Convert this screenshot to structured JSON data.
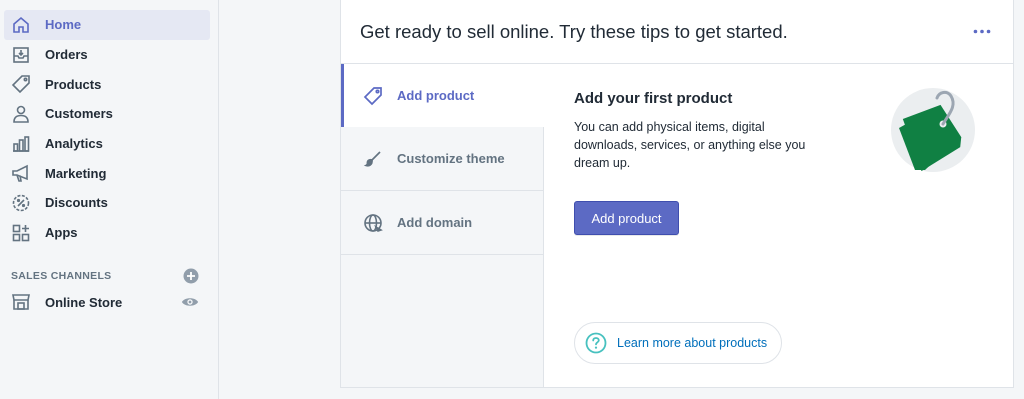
{
  "sidebar": {
    "items": [
      {
        "label": "Home",
        "icon": "home-icon",
        "active": true
      },
      {
        "label": "Orders",
        "icon": "orders-icon"
      },
      {
        "label": "Products",
        "icon": "tag-icon"
      },
      {
        "label": "Customers",
        "icon": "person-icon"
      },
      {
        "label": "Analytics",
        "icon": "bar-chart-icon"
      },
      {
        "label": "Marketing",
        "icon": "megaphone-icon"
      },
      {
        "label": "Discounts",
        "icon": "discount-icon"
      },
      {
        "label": "Apps",
        "icon": "apps-icon"
      }
    ],
    "sales_channels_heading": "SALES CHANNELS",
    "online_store": "Online Store"
  },
  "card": {
    "title": "Get ready to sell online. Try these tips to get started.",
    "tabs": [
      {
        "label": "Add product",
        "icon": "tag-icon",
        "active": true
      },
      {
        "label": "Customize theme",
        "icon": "brush-icon"
      },
      {
        "label": "Add domain",
        "icon": "globe-icon"
      }
    ],
    "panel": {
      "title": "Add your first product",
      "description": "You can add physical items, digital downloads, services, or anything else you dream up.",
      "button": "Add product",
      "learn_more": "Learn more about products"
    }
  },
  "colors": {
    "accent": "#5c6ac4",
    "link": "#006fbb",
    "tag_green": "#108043",
    "help_teal": "#47c1bf"
  }
}
